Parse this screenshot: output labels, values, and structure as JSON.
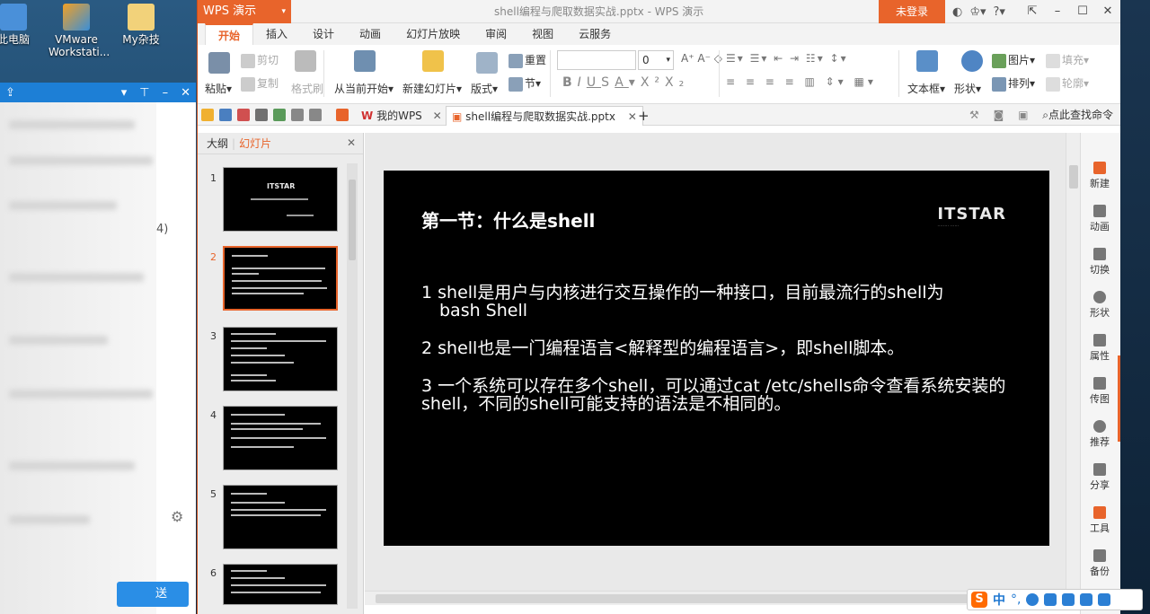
{
  "desktop": {
    "icons": [
      {
        "label": "此电脑",
        "icon": "computer-icon"
      },
      {
        "label": "VMware\nWorkstati...",
        "icon": "vmware-icon"
      },
      {
        "label": "My杂技",
        "icon": "folder-icon"
      }
    ]
  },
  "side_app": {
    "visible_text": "4)",
    "send_label": "送"
  },
  "window": {
    "app_name": "WPS 演示",
    "doc_title": "shell编程与爬取数据实战.pptx - WPS 演示",
    "login": "未登录"
  },
  "menu_tabs": [
    "开始",
    "插入",
    "设计",
    "动画",
    "幻灯片放映",
    "审阅",
    "视图",
    "云服务"
  ],
  "ribbon": {
    "paste": "粘贴",
    "cut": "剪切",
    "copy": "复制",
    "format_painter": "格式刷",
    "from_current": "从当前开始",
    "new_slide": "新建幻灯片",
    "layout": "版式",
    "reset": "重置",
    "section": "节",
    "font_size": "0",
    "textbox": "文本框",
    "shape": "形状",
    "picture": "图片",
    "fill": "填充",
    "arrange": "排列",
    "outline": "轮廓"
  },
  "quickbar": {
    "tab_mywps": "我的WPS",
    "tab_doc": "shell编程与爬取数据实战.pptx",
    "search_cmd": "点此查找命令"
  },
  "pane": {
    "tab_outline": "大纲",
    "tab_slides": "幻灯片",
    "slide_numbers": [
      "1",
      "2",
      "3",
      "4",
      "5",
      "6"
    ]
  },
  "slide": {
    "title": "第一节：什么是shell",
    "logo": "ITSTAR",
    "p1a": "1 shell是用户与内核进行交互操作的一种接口，目前最流行的shell为",
    "p1b": "bash Shell",
    "p2": "2 shell也是一门编程语言<解释型的编程语言>，即shell脚本。",
    "p3": "3 一个系统可以存在多个shell，可以通过cat /etc/shells命令查看系统安装的shell，不同的shell可能支持的语法是不相同的。"
  },
  "taskpane": [
    "新建",
    "动画",
    "切换",
    "形状",
    "属性",
    "传图",
    "推荐",
    "分享",
    "工具",
    "备份"
  ],
  "ime": {
    "lang": "中"
  },
  "colors": {
    "accent": "#e8642b",
    "slide_bg": "#000000"
  }
}
